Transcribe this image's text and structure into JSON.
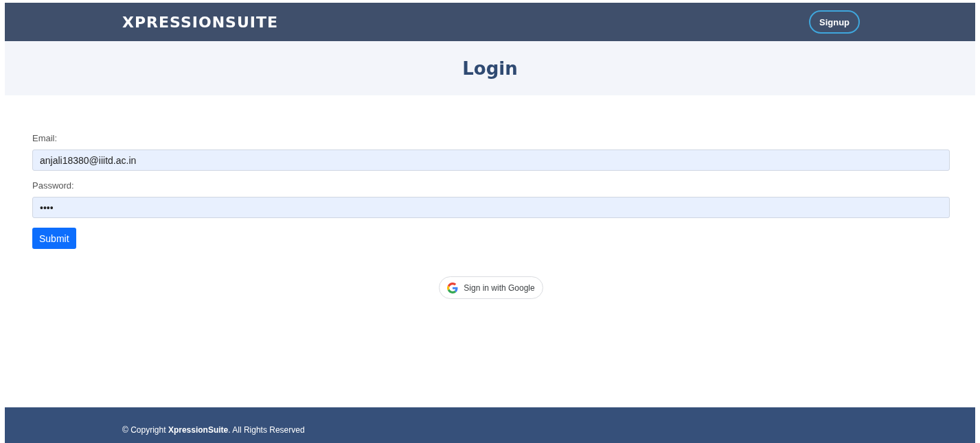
{
  "header": {
    "brand": "XPRESSIONSUITE",
    "signup_button": "Signup"
  },
  "page_title": "Login",
  "form": {
    "fields": [
      {
        "label": "Email:",
        "value": "anjali18380@iiitd.ac.in"
      },
      {
        "label": "Password:",
        "value": "••••"
      }
    ],
    "submit_button": "Submit"
  },
  "google_button": "Sign in with Google",
  "footer": {
    "text": "© Copyright **XpressionSuite**. All Rights Reserved"
  }
}
